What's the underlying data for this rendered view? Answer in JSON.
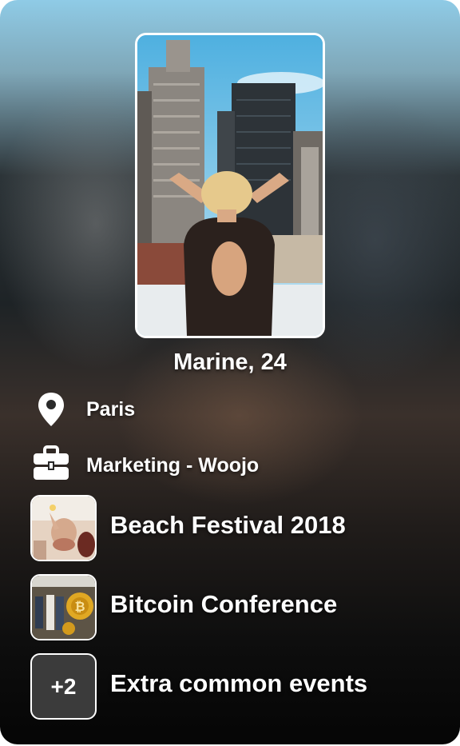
{
  "profile": {
    "name_age": "Marine, 24",
    "photo_icon": "profile-photo"
  },
  "details": [
    {
      "icon": "location-pin-icon",
      "text": "Paris"
    },
    {
      "icon": "briefcase-icon",
      "text": "Marketing - Woojo"
    }
  ],
  "events": [
    {
      "label": "Beach Festival 2018",
      "thumb": "festival-photo"
    },
    {
      "label": "Bitcoin Conference",
      "thumb": "bitcoin-photo"
    },
    {
      "label": "Extra common events",
      "badge": "+2"
    }
  ],
  "colors": {
    "text": "#ffffff",
    "badge_bg": "#3b3b3b",
    "sky": "#5cb2dc"
  }
}
